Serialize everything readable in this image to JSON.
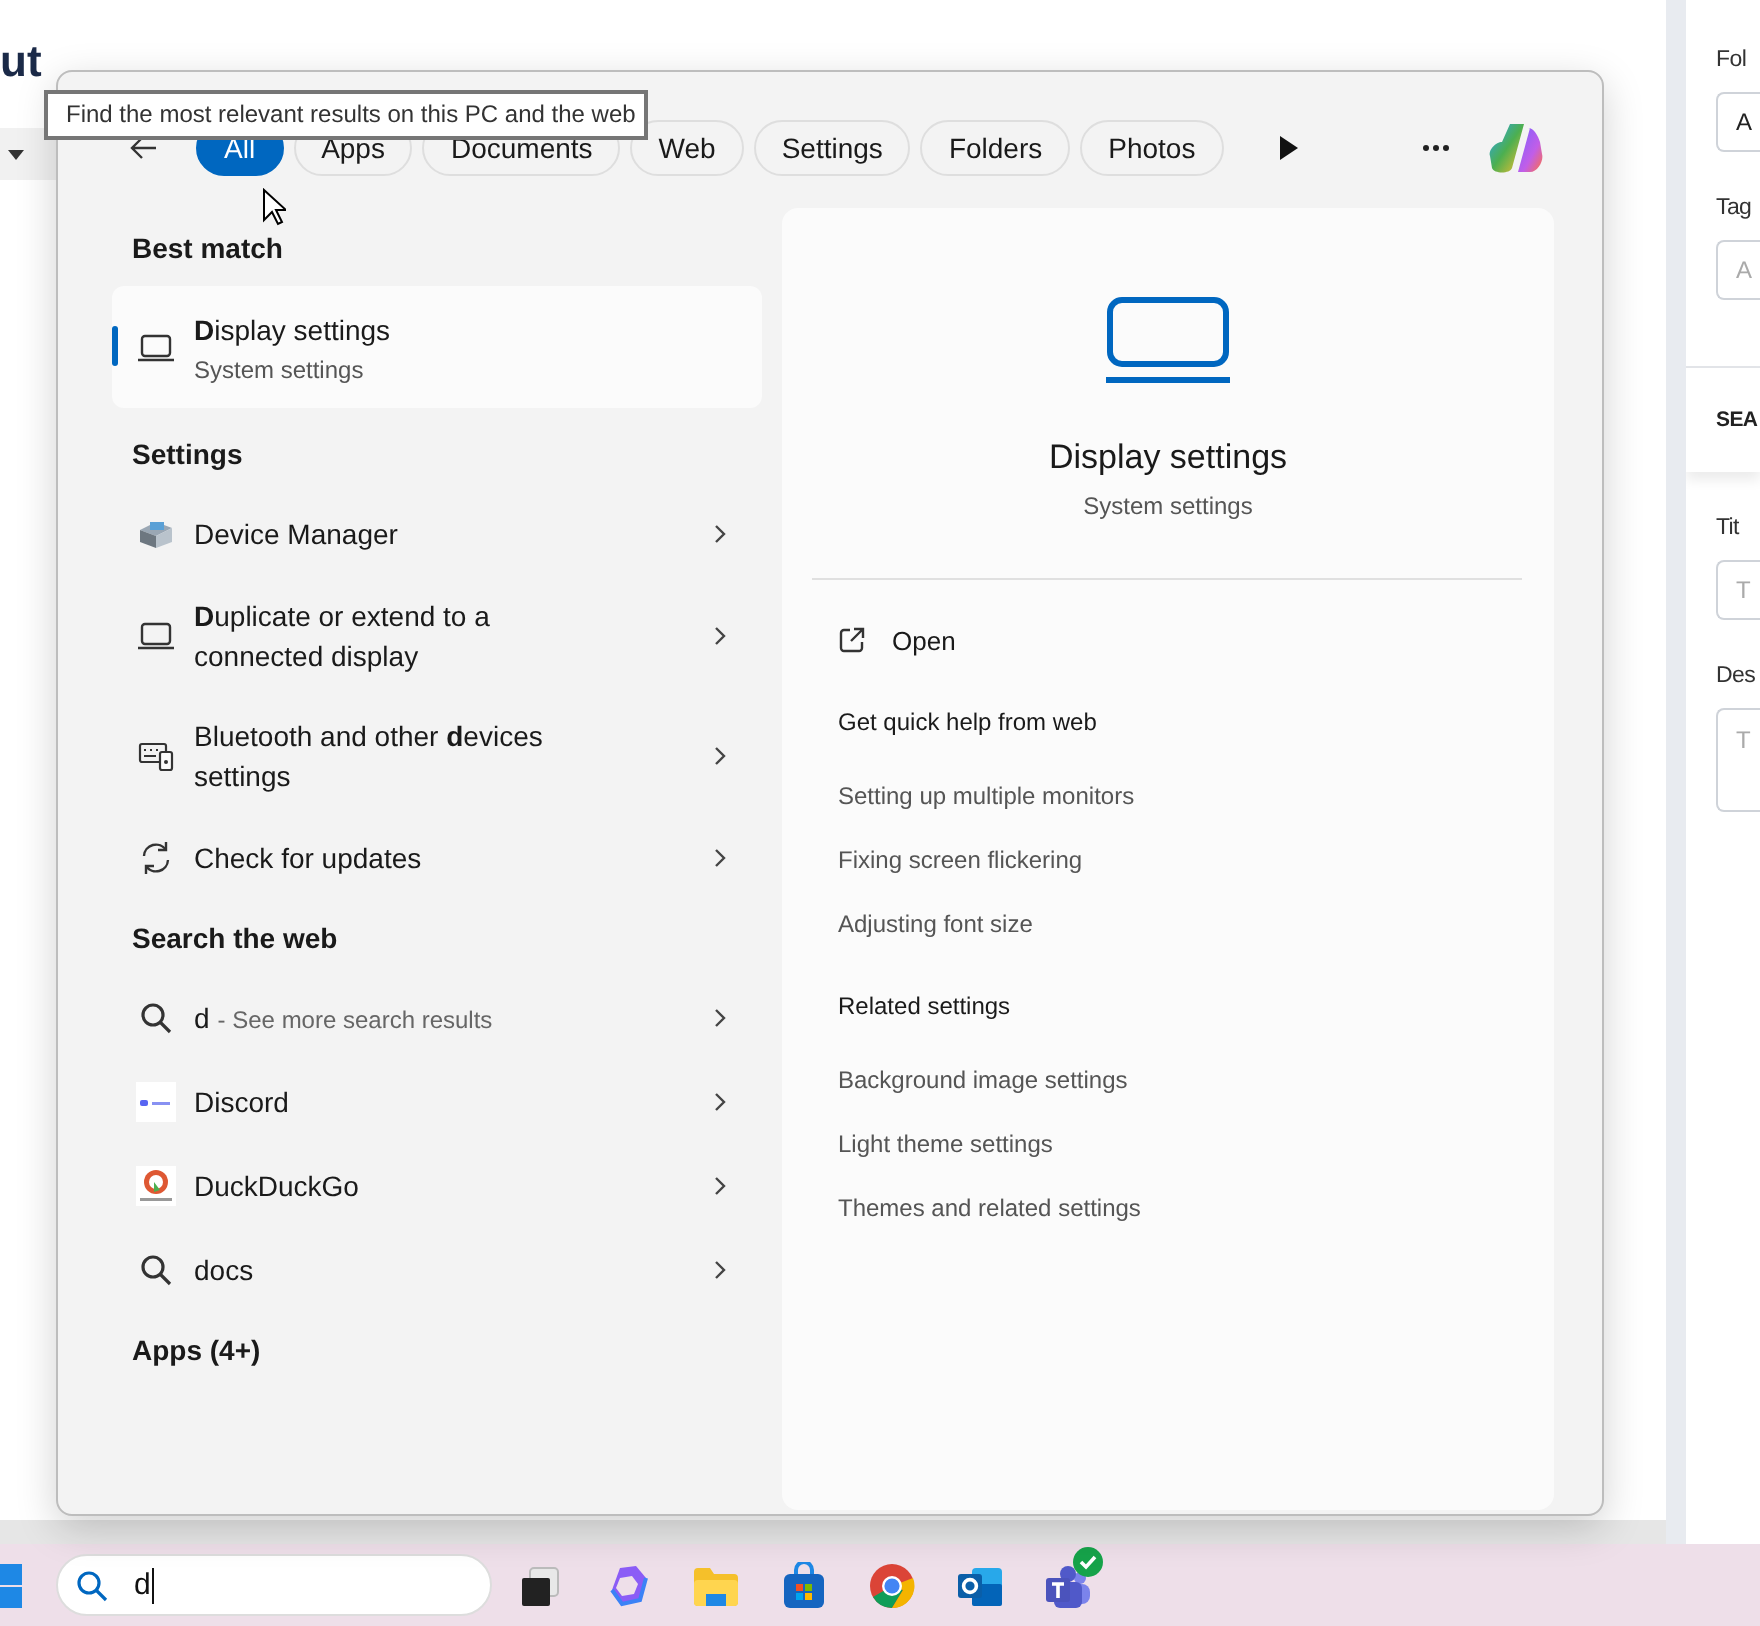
{
  "background_page": {
    "title": "ut",
    "side_panel": {
      "fields": [
        {
          "label": "Fol",
          "value": "A"
        },
        {
          "label": "Tag",
          "placeholder": "A"
        }
      ],
      "section": "SEA",
      "section_fields": [
        {
          "label": "Tit",
          "placeholder": "T",
          "kind": "input"
        },
        {
          "label": "Des",
          "placeholder": "T",
          "kind": "textarea"
        }
      ]
    }
  },
  "tooltip": "Find the most relevant results on this PC and the web",
  "search_panel": {
    "filters": [
      {
        "label": "All",
        "selected": true
      },
      {
        "label": "Apps",
        "selected": false
      },
      {
        "label": "Documents",
        "selected": false
      },
      {
        "label": "Web",
        "selected": false
      },
      {
        "label": "Settings",
        "selected": false
      },
      {
        "label": "Folders",
        "selected": false
      },
      {
        "label": "Photos",
        "selected": false
      }
    ],
    "sections": [
      {
        "heading": "Best match",
        "results": [
          {
            "kind": "laptop",
            "title": "**D**isplay settings",
            "subtitle": "System settings",
            "selected": true,
            "chevron": false
          }
        ]
      },
      {
        "heading": "Settings",
        "results": [
          {
            "kind": "device",
            "title": "Device Manager",
            "selected": false,
            "chevron": true
          },
          {
            "kind": "laptop",
            "title": "**D**uplicate or extend to a connected display",
            "selected": false,
            "chevron": true
          },
          {
            "kind": "keyboard",
            "title": "Bluetooth and other **d**evices settings",
            "selected": false,
            "chevron": true
          },
          {
            "kind": "sync",
            "title": "Check for updates",
            "selected": false,
            "chevron": true
          }
        ]
      },
      {
        "heading": "Search the web",
        "results": [
          {
            "kind": "search",
            "title": "d",
            "hint": "- See more search results",
            "selected": false,
            "chevron": true
          },
          {
            "kind": "thumbnail",
            "title": "Discord",
            "selected": false,
            "chevron": true
          },
          {
            "kind": "logo",
            "title": "DuckDuckGo",
            "selected": false,
            "chevron": true
          },
          {
            "kind": "search",
            "title": "docs",
            "selected": false,
            "chevron": true
          }
        ]
      },
      {
        "heading": "Apps (4+)"
      }
    ],
    "preview": {
      "title": "Display settings",
      "subtitle": "System settings",
      "action": "Open",
      "groups": [
        {
          "heading": "Get quick help from web",
          "links": [
            "Setting up multiple monitors",
            "Fixing screen flickering",
            "Adjusting font size"
          ]
        },
        {
          "heading": "Related settings",
          "links": [
            "Background image settings",
            "Light theme settings",
            "Themes and related settings"
          ]
        }
      ]
    }
  },
  "taskbar": {
    "search": {
      "value": "d"
    },
    "apps": [
      {
        "kind": "taskview",
        "notified": false
      },
      {
        "kind": "ribbon",
        "notified": false
      },
      {
        "kind": "folder",
        "notified": false
      },
      {
        "kind": "store",
        "notified": false
      },
      {
        "kind": "browser",
        "notified": false
      },
      {
        "kind": "mail",
        "notified": false
      },
      {
        "kind": "team",
        "notified": true
      }
    ]
  }
}
